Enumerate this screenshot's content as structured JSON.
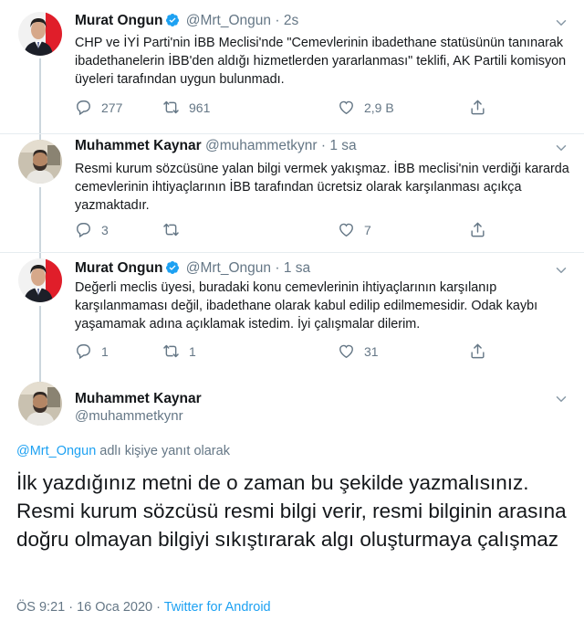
{
  "colors": {
    "accent": "#1da1f2",
    "muted": "#657786",
    "text": "#14171a",
    "verified": "#1da1f2"
  },
  "tweets": [
    {
      "name": "Murat Ongun",
      "handle": "@Mrt_Ongun",
      "sep": "·",
      "time": "2s",
      "verified": true,
      "text": "CHP ve İYİ Parti'nin İBB Meclisi'nde \"Cemevlerinin ibadethane statüsünün tanınarak ibadethanelerin İBB'den aldığı hizmetlerden yararlanması\" teklifi, AK Partili komisyon üyeleri tarafından uygun bulunmadı.",
      "replies": "277",
      "retweets": "961",
      "likes": "2,9 B"
    },
    {
      "name": "Muhammet Kaynar",
      "handle": "@muhammetkynr",
      "sep": "·",
      "time": "1 sa",
      "verified": false,
      "text": "Resmi kurum sözcüsüne yalan bilgi vermek yakışmaz. İBB meclisi'nin verdiği kararda cemevlerinin ihtiyaçlarının İBB tarafından ücretsiz olarak karşılanması açıkça yazmaktadır.",
      "replies": "3",
      "retweets": "",
      "likes": "7"
    },
    {
      "name": "Murat Ongun",
      "handle": "@Mrt_Ongun",
      "sep": "·",
      "time": "1 sa",
      "verified": true,
      "text": "Değerli meclis üyesi, buradaki konu cemevlerinin ihtiyaçlarının karşılanıp karşılanmaması değil, ibadethane olarak kabul edilip edilmemesidir. Odak kaybı yaşamamak adına açıklamak istedim. İyi çalışmalar dilerim.",
      "replies": "1",
      "retweets": "1",
      "likes": "31"
    }
  ],
  "main": {
    "name": "Muhammet Kaynar",
    "handle": "@muhammetkynr",
    "reply_mention": "@Mrt_Ongun",
    "reply_suffix": " adlı kişiye yanıt olarak",
    "text": "İlk yazdığınız metni de o zaman bu şekilde yazmalısınız. Resmi kurum sözcüsü resmi bilgi verir, resmi bilginin arasına doğru olmayan bilgiyi sıkıştırarak algı oluşturmaya çalışmaz",
    "time": "ÖS 9:21 · 16 Oca 2020",
    "sep": " · ",
    "source": "Twitter for Android"
  }
}
